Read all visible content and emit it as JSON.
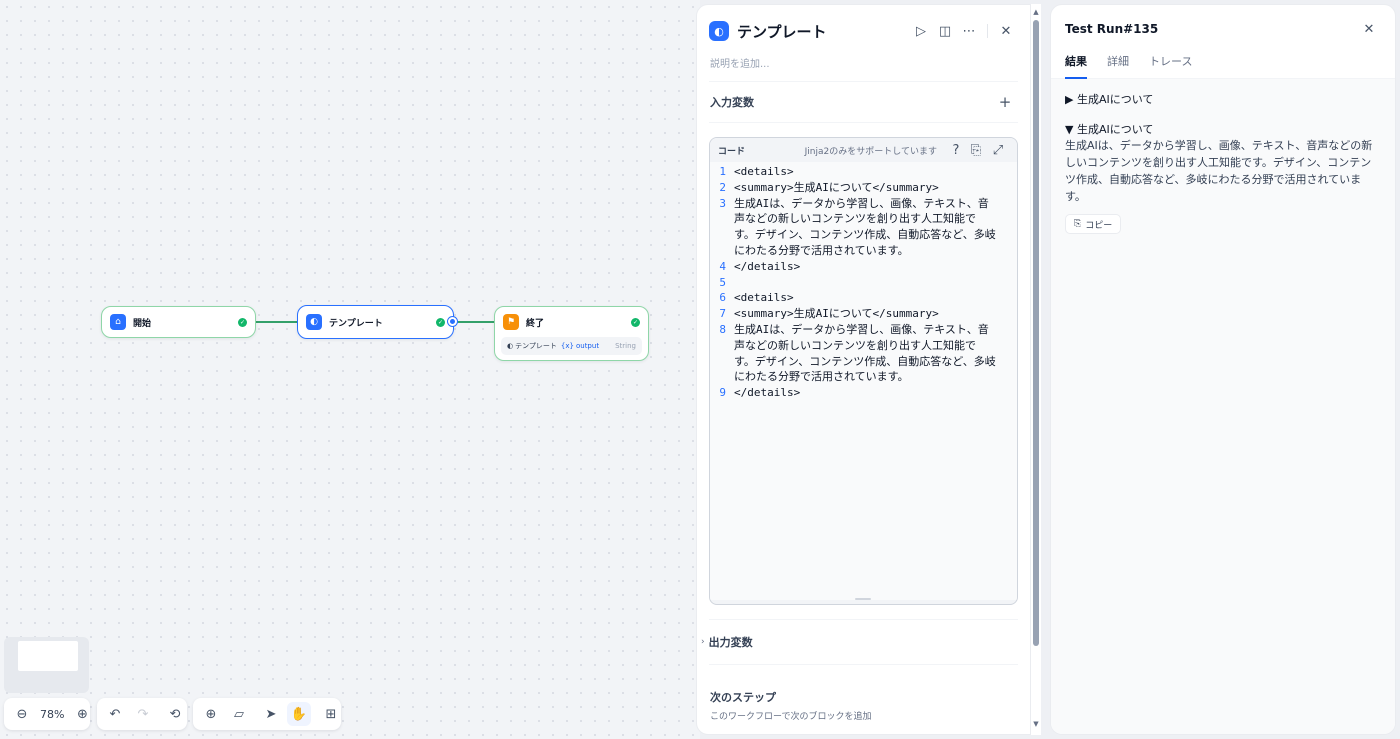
{
  "canvas": {
    "nodes": {
      "start": {
        "title": "開始"
      },
      "template": {
        "title": "テンプレート"
      },
      "end": {
        "title": "終了",
        "output_source": "テンプレート",
        "output_var": "output",
        "output_type": "String"
      }
    },
    "toolbar": {
      "zoom": "78%"
    }
  },
  "template_panel": {
    "title": "テンプレート",
    "description_placeholder": "説明を追加...",
    "input_vars_label": "入力変数",
    "code": {
      "label": "コード",
      "hint": "Jinja2のみをサポートしています",
      "lines": [
        {
          "n": "1",
          "text": "<details>"
        },
        {
          "n": "2",
          "text": "<summary>生成AIについて</summary>"
        },
        {
          "n": "3",
          "text": "生成AIは、データから学習し、画像、テキスト、音声などの新しいコンテンツを創り出す人工知能です。デザイン、コンテンツ作成、自動応答など、多岐にわたる分野で活用されています。"
        },
        {
          "n": "4",
          "text": "</details>"
        },
        {
          "n": "5",
          "text": ""
        },
        {
          "n": "6",
          "text": "<details>"
        },
        {
          "n": "7",
          "text": "<summary>生成AIについて</summary>"
        },
        {
          "n": "8",
          "text": "生成AIは、データから学習し、画像、テキスト、音声などの新しいコンテンツを創り出す人工知能です。デザイン、コンテンツ作成、自動応答など、多岐にわたる分野で活用されています。"
        },
        {
          "n": "9",
          "text": "</details>"
        }
      ]
    },
    "output_vars_label": "出力変数",
    "next_step_title": "次のステップ",
    "next_step_sub": "このワークフローで次のブロックを追加"
  },
  "run_panel": {
    "title": "Test Run#135",
    "tabs": [
      "結果",
      "詳細",
      "トレース"
    ],
    "collapsed_summary": "▶ 生成AIについて",
    "open_summary": "▼ 生成AIについて",
    "open_text": "生成AIは、データから学習し、画像、テキスト、音声などの新しいコンテンツを創り出す人工知能です。デザイン、コンテンツ作成、自動応答など、多岐にわたる分野で活用されています。",
    "copy_label": "コピー"
  },
  "colors": {
    "accent": "#2970ff",
    "success": "#12b76a",
    "end_node": "#f79009"
  }
}
